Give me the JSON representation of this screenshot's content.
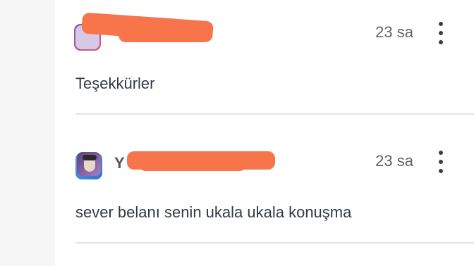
{
  "comments": [
    {
      "username": "",
      "time": "23 sa",
      "text": "Teşekkürler"
    },
    {
      "username": "Y",
      "time": "23 sa",
      "text": "sever belanı senin ukala ukala konuşma"
    }
  ],
  "colors": {
    "redaction": "#f8744a",
    "divider": "#e2e2e2",
    "gutter": "#f6f6f7"
  }
}
